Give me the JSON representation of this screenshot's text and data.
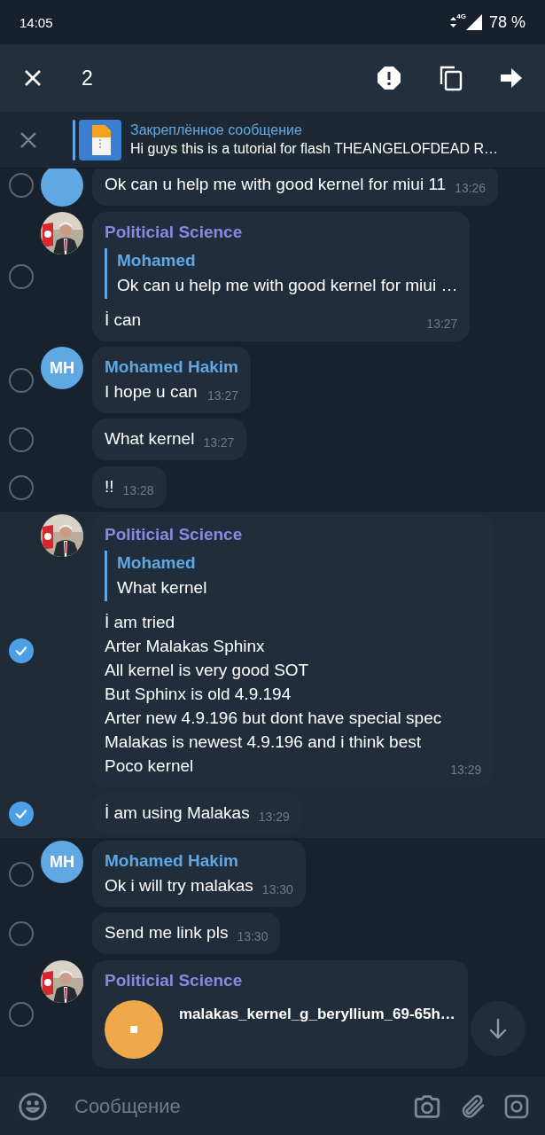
{
  "status_bar": {
    "time": "14:05",
    "network": "4G",
    "battery": "78 %"
  },
  "action_bar": {
    "count": "2"
  },
  "pinned": {
    "title": "Закреплённое сообщение",
    "text": "Hi guys this is a tutorial for flash THEANGELOFDEAD R…"
  },
  "messages": [
    {
      "selected": false,
      "avatar": {
        "kind": "initials"
      },
      "text": "Ok can u help me with good kernel for miui 11",
      "time": "13:26"
    },
    {
      "selected": false,
      "sender": "Politicial Science",
      "color": "#8e86e2",
      "reply": {
        "name": "Mohamed",
        "text": "Ok can u help me with good kernel for miui …"
      },
      "text": "İ can",
      "time": "13:27"
    },
    {
      "selected": false,
      "avatar": {
        "kind": "initials",
        "initials": "MH"
      },
      "sender": "Mohamed Hakim",
      "color": "#5fa8e4",
      "text": "I hope u can",
      "time": "13:27"
    },
    {
      "selected": false,
      "text": "What kernel",
      "time": "13:27"
    },
    {
      "selected": false,
      "text": "!!",
      "time": "13:28"
    },
    {
      "selected": true,
      "sender": "Politicial Science",
      "color": "#8e86e2",
      "reply": {
        "name": "Mohamed",
        "text": "What kernel"
      },
      "text": "İ am tried\nArter Malakas Sphinx\nAll kernel is very good SOT\nBut Sphinx is old 4.9.194\nArter new 4.9.196 but dont have special spec\nMalakas is newest 4.9.196 and i think best\nPoco kernel",
      "time": "13:29"
    },
    {
      "selected": true,
      "text": "İ am using Malakas",
      "time": "13:29"
    },
    {
      "selected": false,
      "avatar": {
        "kind": "initials",
        "initials": "MH"
      },
      "sender": "Mohamed Hakim",
      "color": "#5fa8e4",
      "text": "Ok i will try malakas",
      "time": "13:30"
    },
    {
      "selected": false,
      "text": "Send me link pls",
      "time": "13:30"
    },
    {
      "selected": false,
      "sender": "Politicial Science",
      "color": "#8e86e2",
      "file": {
        "name": "malakas_kernel_g_beryllium_69-65h…"
      }
    }
  ],
  "input": {
    "placeholder": "Сообщение"
  }
}
